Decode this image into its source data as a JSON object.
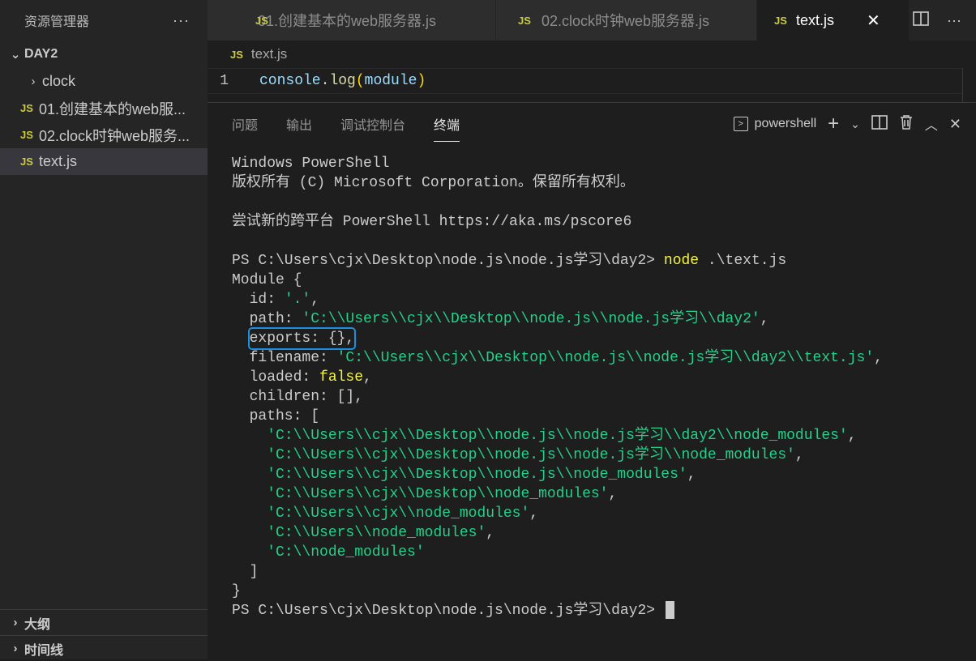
{
  "sidebar": {
    "title": "资源管理器",
    "more": "···",
    "folder": "DAY2",
    "items": [
      {
        "type": "folder",
        "label": "clock"
      },
      {
        "type": "file",
        "badge": "JS",
        "label": "01.创建基本的web服..."
      },
      {
        "type": "file",
        "badge": "JS",
        "label": "02.clock时钟web服务..."
      },
      {
        "type": "file",
        "badge": "JS",
        "label": "text.js"
      }
    ],
    "outline": "大纲",
    "timeline": "时间线"
  },
  "tabs": [
    {
      "badge": "JS",
      "label": "01.创建基本的web服务器.js"
    },
    {
      "badge": "JS",
      "label": "02.clock时钟web服务器.js"
    },
    {
      "badge": "JS",
      "label": "text.js",
      "close": "✕"
    }
  ],
  "editor": {
    "breadcrumb_badge": "JS",
    "breadcrumb": "text.js",
    "line_number": "1",
    "code": {
      "obj": "console",
      "dot": ".",
      "fn": "log",
      "open": "(",
      "arg": "module",
      "close": ")"
    }
  },
  "panel": {
    "tabs": [
      "问题",
      "输出",
      "调试控制台",
      "终端"
    ],
    "terminal_name": "powershell"
  },
  "terminal": {
    "l1": "Windows PowerShell",
    "l2": "版权所有 (C) Microsoft Corporation。保留所有权利。",
    "l3": "尝试新的跨平台 PowerShell https://aka.ms/pscore6",
    "prompt": "PS C:\\Users\\cjx\\Desktop\\node.js\\node.js学习\\day2> ",
    "cmd": "node",
    "cmd_arg": " .\\text.js",
    "module_open": "Module {",
    "id_key": "  id: ",
    "id_val": "'.'",
    "path_key": "  path: ",
    "path_val": "'C:\\\\Users\\\\cjx\\\\Desktop\\\\node.js\\\\node.js学习\\\\day2'",
    "exports": "exports: {},",
    "filename_key": "  filename: ",
    "filename_val": "'C:\\\\Users\\\\cjx\\\\Desktop\\\\node.js\\\\node.js学习\\\\day2\\\\text.js'",
    "loaded_key": "  loaded: ",
    "loaded_val": "false",
    "children": "  children: [],",
    "paths_key": "  paths: [",
    "paths": [
      "'C:\\\\Users\\\\cjx\\\\Desktop\\\\node.js\\\\node.js学习\\\\day2\\\\node_modules'",
      "'C:\\\\Users\\\\cjx\\\\Desktop\\\\node.js\\\\node.js学习\\\\node_modules'",
      "'C:\\\\Users\\\\cjx\\\\Desktop\\\\node.js\\\\node_modules'",
      "'C:\\\\Users\\\\cjx\\\\Desktop\\\\node_modules'",
      "'C:\\\\Users\\\\cjx\\\\node_modules'",
      "'C:\\\\Users\\\\node_modules'",
      "'C:\\\\node_modules'"
    ],
    "paths_close": "  ]",
    "module_close": "}"
  }
}
